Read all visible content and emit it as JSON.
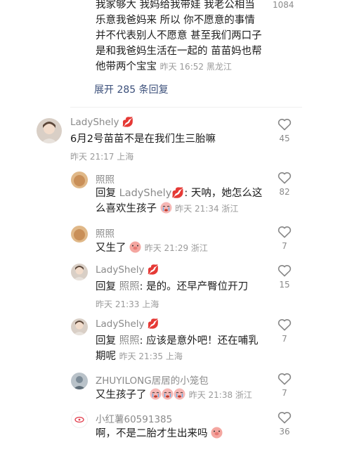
{
  "top_comment": {
    "lines": [
      "我家够大  我妈给我带娃  我老公相当",
      "乐意我爸妈来  所以 你不愿意的事情",
      "并不代表别人不愿意  甚至我们两口子",
      "是和我爸妈生活在一起的  苗苗妈也帮"
    ],
    "last_line": "他带两个宝宝",
    "meta": "昨天 16:52 黑龙江",
    "likes": "1084",
    "expand_label": "展开 285 条回复"
  },
  "comments": [
    {
      "name": "LadyShely",
      "text": "6月2号苗苗不是在我们生三胎嘛",
      "meta": "昨天 21:17 上海",
      "likes": "45"
    },
    {
      "name": "照照",
      "reply_prefix": "回复 ",
      "reply_to": "LadyShely",
      "text_a": ": 天呐，她怎么这",
      "text_b": "么喜欢生孩子",
      "meta": "昨天 21:34 浙江",
      "likes": "82"
    },
    {
      "name": "照照",
      "text": "又生了",
      "meta": "昨天 21:29 浙江",
      "likes": "7"
    },
    {
      "name": "LadyShely",
      "reply_prefix": "回复 ",
      "reply_to": "照照",
      "text": ": 是的。还早产臀位开刀",
      "meta": "昨天 21:33 上海",
      "likes": "15"
    },
    {
      "name": "LadyShely",
      "reply_prefix": "回复 ",
      "reply_to": "照照",
      "text_a": ": 应该是意外吧！还在哺乳",
      "text_b": "期呢",
      "meta": "昨天 21:35 上海",
      "likes": "7"
    },
    {
      "name": "ZHUYILONG居居的小笼包",
      "text": "又生孩子了",
      "meta": "昨天 21:38 浙江",
      "likes": "7"
    },
    {
      "name": "小红薯60591385",
      "text": "啊，不是二胎才生出来吗",
      "meta": "",
      "likes": "36"
    }
  ]
}
